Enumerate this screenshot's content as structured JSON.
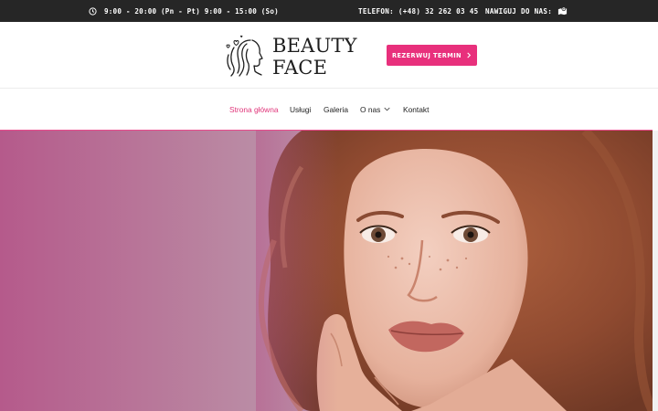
{
  "topbar": {
    "hours": "9:00 - 20:00 (Pn - Pt) 9:00 - 15:00 (So)",
    "phone": "TELEFON: (+48) 32 262 03 45",
    "navigate": "NAWIGUJ DO NAS:",
    "icons": [
      "clock-icon",
      "map-icon"
    ]
  },
  "logo": {
    "line1": "BEAUTY",
    "line2": "FACE"
  },
  "book_button": {
    "label": "REZERWUJ TERMIN",
    "icon": "chevron-right-icon"
  },
  "nav": {
    "items": [
      {
        "label": "Strona główna",
        "active": true
      },
      {
        "label": "Usługi"
      },
      {
        "label": "Galeria"
      },
      {
        "label": "O nas",
        "dropdown": true
      },
      {
        "label": "Kontakt"
      }
    ]
  },
  "colors": {
    "accent": "#e8307c",
    "topbar": "#262626",
    "nav_active": "#e0357a"
  }
}
